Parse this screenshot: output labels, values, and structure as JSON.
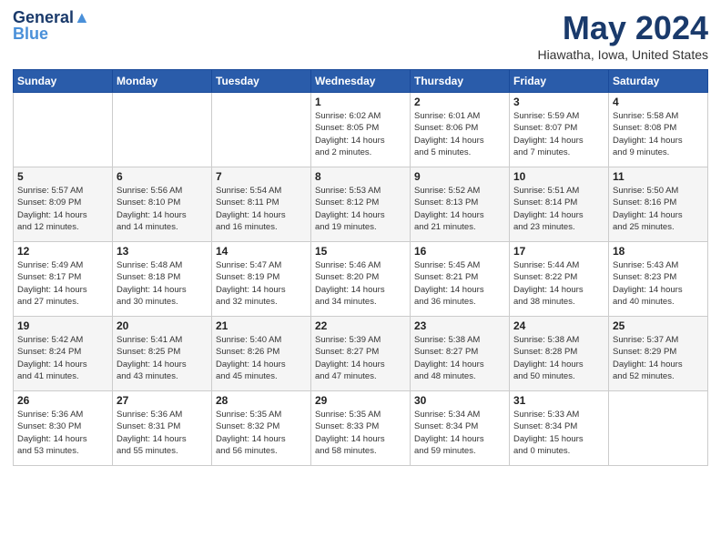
{
  "logo": {
    "line1": "General",
    "line2": "Blue"
  },
  "title": "May 2024",
  "location": "Hiawatha, Iowa, United States",
  "days_of_week": [
    "Sunday",
    "Monday",
    "Tuesday",
    "Wednesday",
    "Thursday",
    "Friday",
    "Saturday"
  ],
  "weeks": [
    [
      {
        "day": "",
        "info": ""
      },
      {
        "day": "",
        "info": ""
      },
      {
        "day": "",
        "info": ""
      },
      {
        "day": "1",
        "info": "Sunrise: 6:02 AM\nSunset: 8:05 PM\nDaylight: 14 hours\nand 2 minutes."
      },
      {
        "day": "2",
        "info": "Sunrise: 6:01 AM\nSunset: 8:06 PM\nDaylight: 14 hours\nand 5 minutes."
      },
      {
        "day": "3",
        "info": "Sunrise: 5:59 AM\nSunset: 8:07 PM\nDaylight: 14 hours\nand 7 minutes."
      },
      {
        "day": "4",
        "info": "Sunrise: 5:58 AM\nSunset: 8:08 PM\nDaylight: 14 hours\nand 9 minutes."
      }
    ],
    [
      {
        "day": "5",
        "info": "Sunrise: 5:57 AM\nSunset: 8:09 PM\nDaylight: 14 hours\nand 12 minutes."
      },
      {
        "day": "6",
        "info": "Sunrise: 5:56 AM\nSunset: 8:10 PM\nDaylight: 14 hours\nand 14 minutes."
      },
      {
        "day": "7",
        "info": "Sunrise: 5:54 AM\nSunset: 8:11 PM\nDaylight: 14 hours\nand 16 minutes."
      },
      {
        "day": "8",
        "info": "Sunrise: 5:53 AM\nSunset: 8:12 PM\nDaylight: 14 hours\nand 19 minutes."
      },
      {
        "day": "9",
        "info": "Sunrise: 5:52 AM\nSunset: 8:13 PM\nDaylight: 14 hours\nand 21 minutes."
      },
      {
        "day": "10",
        "info": "Sunrise: 5:51 AM\nSunset: 8:14 PM\nDaylight: 14 hours\nand 23 minutes."
      },
      {
        "day": "11",
        "info": "Sunrise: 5:50 AM\nSunset: 8:16 PM\nDaylight: 14 hours\nand 25 minutes."
      }
    ],
    [
      {
        "day": "12",
        "info": "Sunrise: 5:49 AM\nSunset: 8:17 PM\nDaylight: 14 hours\nand 27 minutes."
      },
      {
        "day": "13",
        "info": "Sunrise: 5:48 AM\nSunset: 8:18 PM\nDaylight: 14 hours\nand 30 minutes."
      },
      {
        "day": "14",
        "info": "Sunrise: 5:47 AM\nSunset: 8:19 PM\nDaylight: 14 hours\nand 32 minutes."
      },
      {
        "day": "15",
        "info": "Sunrise: 5:46 AM\nSunset: 8:20 PM\nDaylight: 14 hours\nand 34 minutes."
      },
      {
        "day": "16",
        "info": "Sunrise: 5:45 AM\nSunset: 8:21 PM\nDaylight: 14 hours\nand 36 minutes."
      },
      {
        "day": "17",
        "info": "Sunrise: 5:44 AM\nSunset: 8:22 PM\nDaylight: 14 hours\nand 38 minutes."
      },
      {
        "day": "18",
        "info": "Sunrise: 5:43 AM\nSunset: 8:23 PM\nDaylight: 14 hours\nand 40 minutes."
      }
    ],
    [
      {
        "day": "19",
        "info": "Sunrise: 5:42 AM\nSunset: 8:24 PM\nDaylight: 14 hours\nand 41 minutes."
      },
      {
        "day": "20",
        "info": "Sunrise: 5:41 AM\nSunset: 8:25 PM\nDaylight: 14 hours\nand 43 minutes."
      },
      {
        "day": "21",
        "info": "Sunrise: 5:40 AM\nSunset: 8:26 PM\nDaylight: 14 hours\nand 45 minutes."
      },
      {
        "day": "22",
        "info": "Sunrise: 5:39 AM\nSunset: 8:27 PM\nDaylight: 14 hours\nand 47 minutes."
      },
      {
        "day": "23",
        "info": "Sunrise: 5:38 AM\nSunset: 8:27 PM\nDaylight: 14 hours\nand 48 minutes."
      },
      {
        "day": "24",
        "info": "Sunrise: 5:38 AM\nSunset: 8:28 PM\nDaylight: 14 hours\nand 50 minutes."
      },
      {
        "day": "25",
        "info": "Sunrise: 5:37 AM\nSunset: 8:29 PM\nDaylight: 14 hours\nand 52 minutes."
      }
    ],
    [
      {
        "day": "26",
        "info": "Sunrise: 5:36 AM\nSunset: 8:30 PM\nDaylight: 14 hours\nand 53 minutes."
      },
      {
        "day": "27",
        "info": "Sunrise: 5:36 AM\nSunset: 8:31 PM\nDaylight: 14 hours\nand 55 minutes."
      },
      {
        "day": "28",
        "info": "Sunrise: 5:35 AM\nSunset: 8:32 PM\nDaylight: 14 hours\nand 56 minutes."
      },
      {
        "day": "29",
        "info": "Sunrise: 5:35 AM\nSunset: 8:33 PM\nDaylight: 14 hours\nand 58 minutes."
      },
      {
        "day": "30",
        "info": "Sunrise: 5:34 AM\nSunset: 8:34 PM\nDaylight: 14 hours\nand 59 minutes."
      },
      {
        "day": "31",
        "info": "Sunrise: 5:33 AM\nSunset: 8:34 PM\nDaylight: 15 hours\nand 0 minutes."
      },
      {
        "day": "",
        "info": ""
      }
    ]
  ]
}
